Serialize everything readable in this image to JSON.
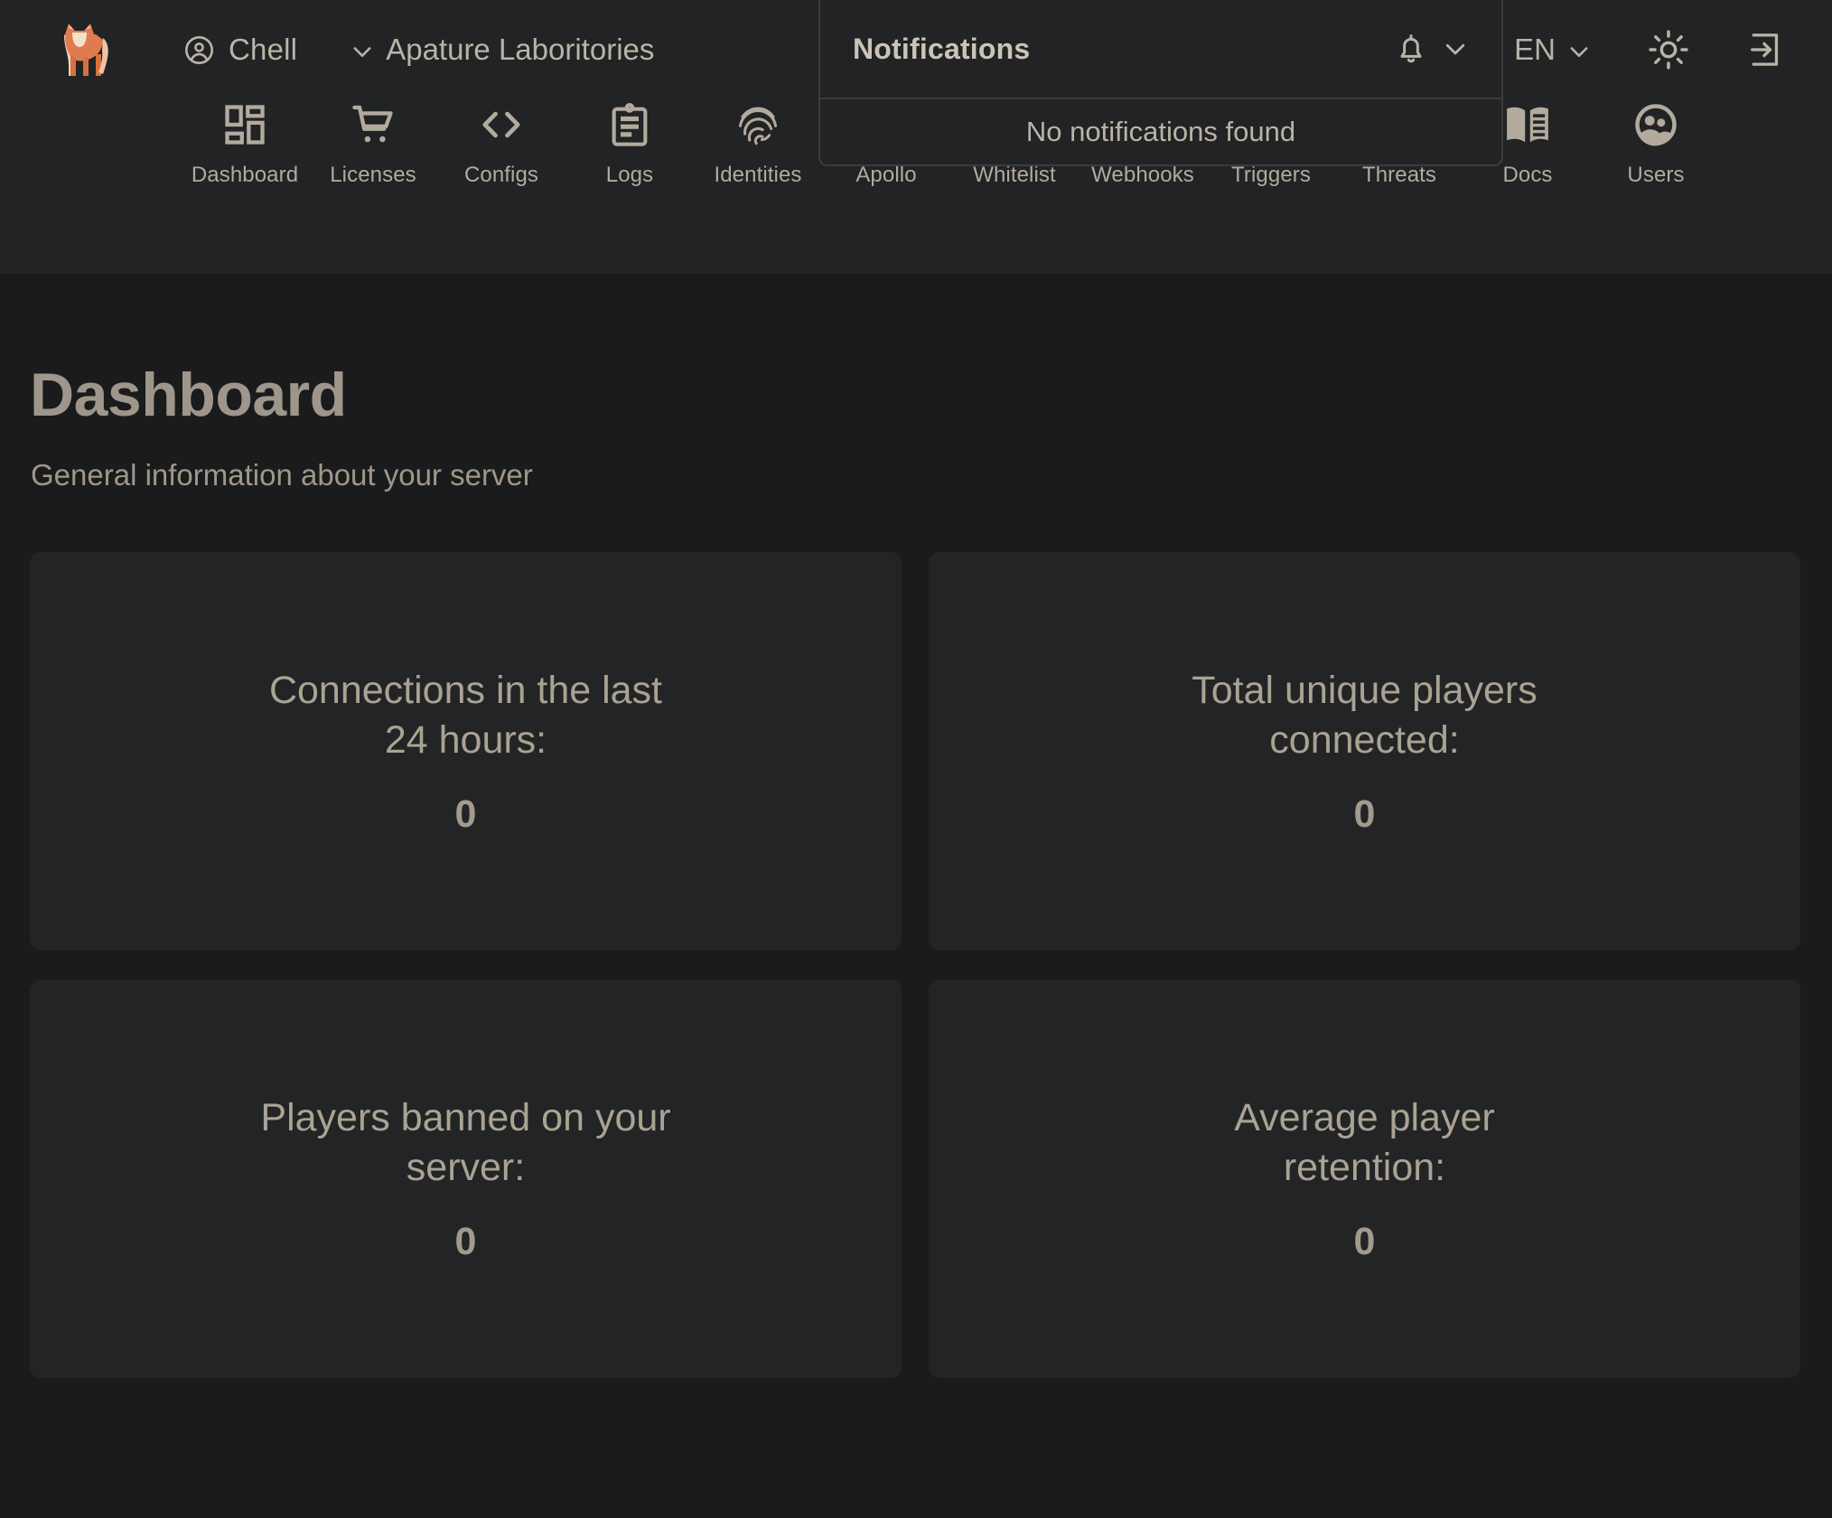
{
  "header": {
    "logo_icon": "fox-logo",
    "user": {
      "name": "Chell",
      "icon": "user-circle-icon"
    },
    "organization": {
      "name": "Apature Laboritories",
      "icon": "chevron-down-icon"
    },
    "language": {
      "value": "EN",
      "icon": "chevron-down-icon"
    },
    "theme_toggle_icon": "sun-icon",
    "logout_icon": "logout-icon"
  },
  "notifications": {
    "title": "Notifications",
    "bell_icon": "bell-icon",
    "chevron_icon": "chevron-down-icon",
    "empty_message": "No notifications found"
  },
  "nav": {
    "items": [
      {
        "label": "Dashboard",
        "icon": "dashboard-grid-icon"
      },
      {
        "label": "Licenses",
        "icon": "shopping-cart-icon"
      },
      {
        "label": "Configs",
        "icon": "code-brackets-icon"
      },
      {
        "label": "Logs",
        "icon": "clipboard-list-icon"
      },
      {
        "label": "Identities",
        "icon": "fingerprint-icon"
      },
      {
        "label": "Apollo",
        "icon": "gamepad-icon"
      },
      {
        "label": "Whitelist",
        "icon": "checklist-icon"
      },
      {
        "label": "Webhooks",
        "icon": "send-arrow-icon"
      },
      {
        "label": "Triggers",
        "icon": "flame-circle-icon"
      },
      {
        "label": "Threats",
        "icon": "warning-triangle-icon"
      },
      {
        "label": "Docs",
        "icon": "book-icon"
      },
      {
        "label": "Users",
        "icon": "users-circle-icon"
      }
    ]
  },
  "page": {
    "title": "Dashboard",
    "subtitle": "General information about your server"
  },
  "cards": [
    {
      "label": "Connections in the last 24 hours:",
      "value": "0"
    },
    {
      "label": "Total unique players connected:",
      "value": "0"
    },
    {
      "label": "Players banned on your server:",
      "value": "0"
    },
    {
      "label": "Average player retention:",
      "value": "0"
    }
  ],
  "colors": {
    "page_background": "#1a1b1c",
    "header_background": "#212324",
    "card_background": "#232425",
    "text_primary": "#bbb3a7",
    "text_muted": "#a09789",
    "accent_logo_orange": "#e07b4f",
    "panel_border": "#3a3c3d"
  }
}
